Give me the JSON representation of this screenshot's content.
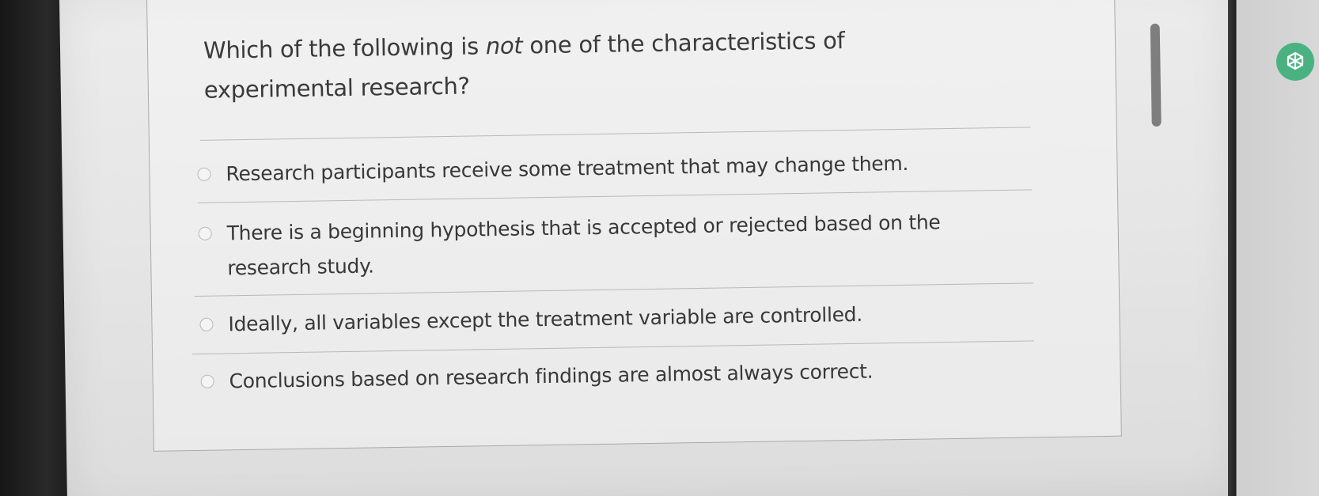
{
  "question": {
    "prefix": "Which of the following is ",
    "emphasis": "not",
    "suffix": " one of the characteristics of experimental research?"
  },
  "options": [
    {
      "label": "Research participants receive some treatment that may change them.",
      "selected": false
    },
    {
      "label": "There is a beginning hypothesis that is accepted or rejected based on the research study.",
      "selected": false
    },
    {
      "label": "Ideally, all variables except the treatment variable are controlled.",
      "selected": false
    },
    {
      "label": "Conclusions based on research findings are almost always correct.",
      "selected": false
    }
  ],
  "extension": {
    "icon": "chatgpt-icon",
    "color": "#4ab280"
  },
  "colors": {
    "text": "#383838",
    "radio_border": "#b8b8b8",
    "scroll_thumb": "#7e7e7e"
  }
}
